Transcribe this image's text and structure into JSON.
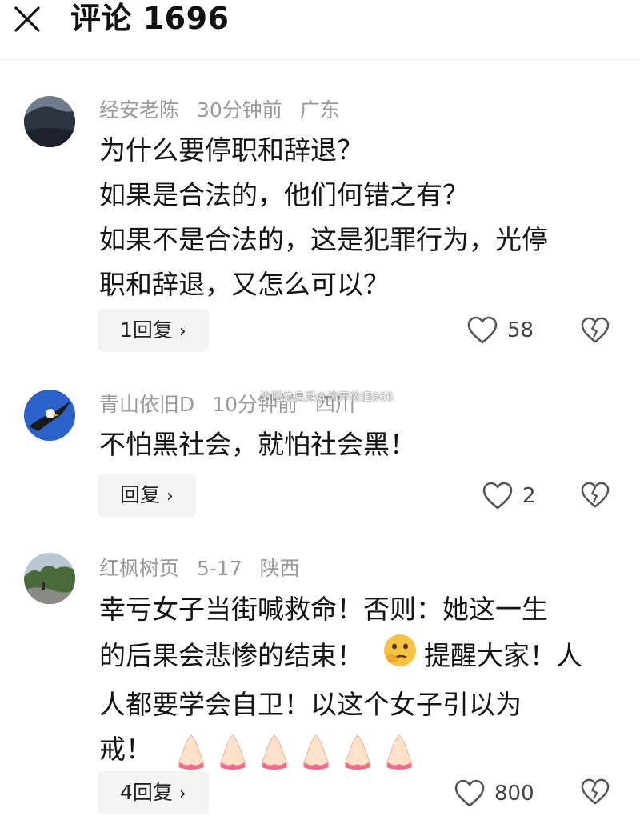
{
  "header": {
    "title": "评论 1696",
    "close_icon": "close-icon"
  },
  "watermark": "洛阳信息港@涛声依旧666",
  "comments": [
    {
      "username": "经安老陈",
      "time": "30分钟前",
      "location": "广东",
      "lines": [
        "为什么要停职和辞退？",
        "如果是合法的，他们何错之有？",
        "如果不是合法的，这是犯罪行为，光停",
        "职和辞退，又怎么可以？"
      ],
      "reply_label": "1回复",
      "likes": "58"
    },
    {
      "username": "青山依旧D",
      "time": "10分钟前",
      "location": "四川",
      "lines": [
        "不怕黑社会，就怕社会黑！"
      ],
      "reply_label": "回复",
      "likes": "2"
    },
    {
      "username": "红枫树页",
      "time": "5-17",
      "location": "陕西",
      "lines": [
        "幸亏女子当街喊救命！否则：她这一生",
        "的后果会悲惨的结束！",
        "提醒大家！人",
        "人都要学会自卫！以这个女子引以为",
        "戒！"
      ],
      "reply_label": "4回复",
      "likes": "800"
    }
  ],
  "icons": {
    "chevron": "›",
    "like": "heart-outline-icon",
    "dislike": "broken-heart-icon"
  }
}
